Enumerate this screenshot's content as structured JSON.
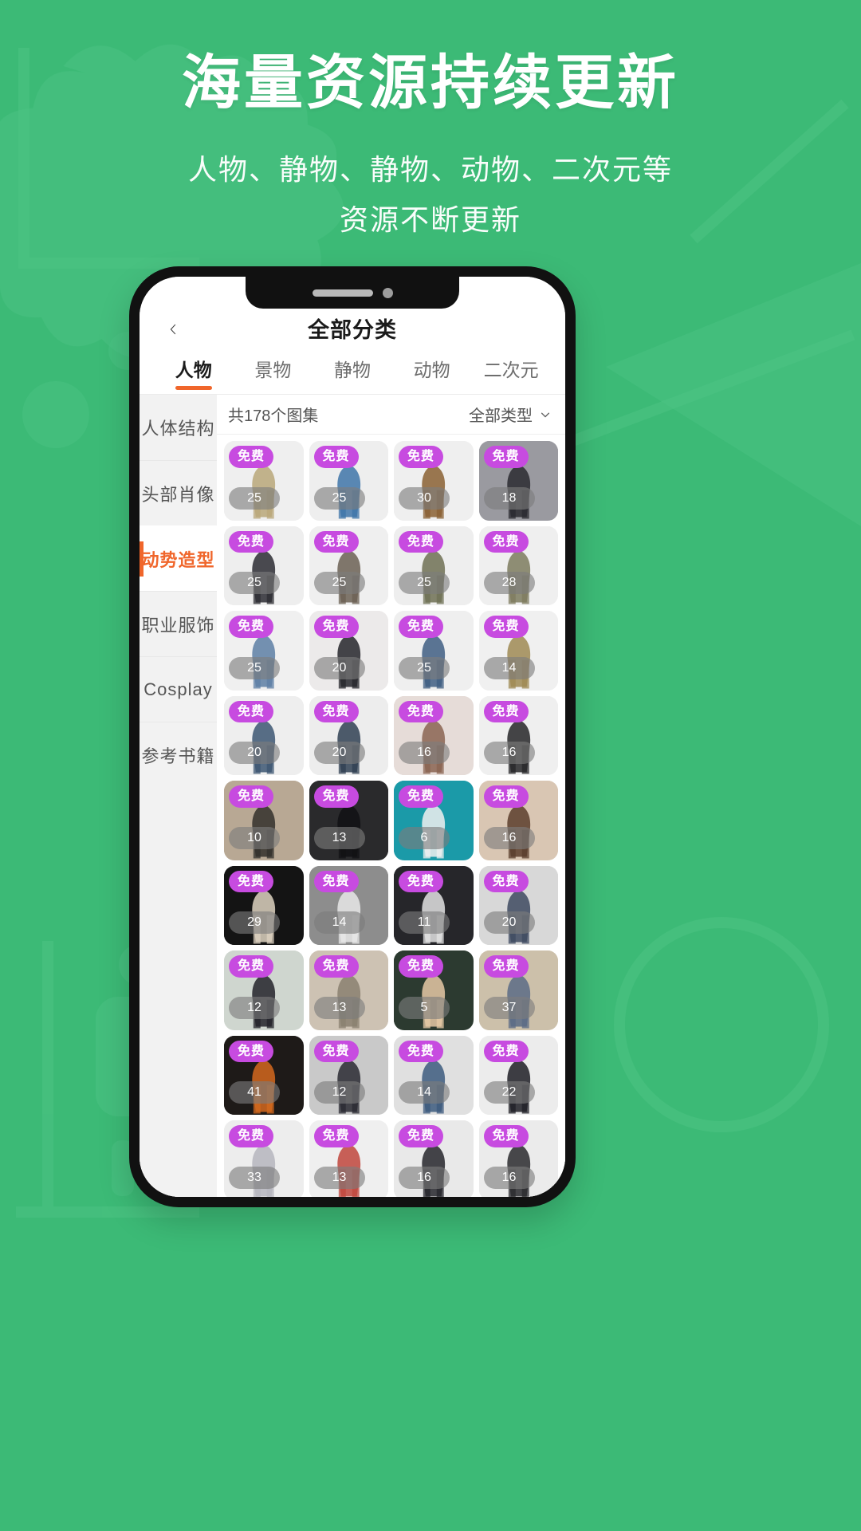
{
  "theme": {
    "bg_green": "#3cba76",
    "accent_orange": "#f0662b",
    "badge_purple": "#c74be0"
  },
  "hero": {
    "title": "海量资源持续更新",
    "subtitle_line1": "人物、静物、静物、动物、二次元等",
    "subtitle_line2": "资源不断更新"
  },
  "app": {
    "nav": {
      "back_icon": "chevron-left-icon",
      "title": "全部分类"
    },
    "tabs": [
      {
        "label": "人物",
        "active": true
      },
      {
        "label": "景物",
        "active": false
      },
      {
        "label": "静物",
        "active": false
      },
      {
        "label": "动物",
        "active": false
      },
      {
        "label": "二次元",
        "active": false
      }
    ],
    "sidebar": [
      {
        "label": "人体结构",
        "active": false
      },
      {
        "label": "头部肖像",
        "active": false
      },
      {
        "label": "动势造型",
        "active": true
      },
      {
        "label": "职业服饰",
        "active": false
      },
      {
        "label": "Cosplay",
        "active": false
      },
      {
        "label": "参考书籍",
        "active": false
      }
    ],
    "content_header": {
      "count_text": "共178个图集",
      "filter_label": "全部类型",
      "filter_icon": "chevron-down-icon"
    },
    "grid": {
      "free_badge_label": "免费",
      "items": [
        {
          "count": "25",
          "tone": "#efefef",
          "figure": "#b9a779"
        },
        {
          "count": "25",
          "tone": "#eeeeee",
          "figure": "#3e74a8"
        },
        {
          "count": "30",
          "tone": "#efefef",
          "figure": "#8a6033"
        },
        {
          "count": "18",
          "tone": "#9a9aa0",
          "figure": "#2a2a30"
        },
        {
          "count": "25",
          "tone": "#eeeeee",
          "figure": "#2c2c32"
        },
        {
          "count": "25",
          "tone": "#efefef",
          "figure": "#6b6053"
        },
        {
          "count": "25",
          "tone": "#eeeeee",
          "figure": "#6e7054"
        },
        {
          "count": "28",
          "tone": "#efefef",
          "figure": "#7d7b5e"
        },
        {
          "count": "25",
          "tone": "#f0f0f0",
          "figure": "#5d7fa5"
        },
        {
          "count": "20",
          "tone": "#eceaea",
          "figure": "#26262b"
        },
        {
          "count": "25",
          "tone": "#efefef",
          "figure": "#3f5e82"
        },
        {
          "count": "14",
          "tone": "#f0f0f0",
          "figure": "#9f8a53"
        },
        {
          "count": "20",
          "tone": "#eeeeee",
          "figure": "#3c5672"
        },
        {
          "count": "20",
          "tone": "#ededed",
          "figure": "#2f3f52"
        },
        {
          "count": "16",
          "tone": "#e6dcd8",
          "figure": "#8a6452"
        },
        {
          "count": "16",
          "tone": "#efefef",
          "figure": "#262628"
        },
        {
          "count": "10",
          "tone": "#b8a894",
          "figure": "#32302c"
        },
        {
          "count": "13",
          "tone": "#2a2a2c",
          "figure": "#111114"
        },
        {
          "count": "6",
          "tone": "#1b9aa8",
          "figure": "#f0f0f0"
        },
        {
          "count": "16",
          "tone": "#d9c6b3",
          "figure": "#5a3d2c"
        },
        {
          "count": "29",
          "tone": "#141414",
          "figure": "#ddd2c0"
        },
        {
          "count": "14",
          "tone": "#8d8d8d",
          "figure": "#e8e8e8"
        },
        {
          "count": "11",
          "tone": "#26262a",
          "figure": "#e3e3e3"
        },
        {
          "count": "20",
          "tone": "#d8d8d8",
          "figure": "#3e4a60"
        },
        {
          "count": "12",
          "tone": "#cfd6cf",
          "figure": "#23232a"
        },
        {
          "count": "13",
          "tone": "#cdc2b3",
          "figure": "#8a8070"
        },
        {
          "count": "5",
          "tone": "#2c3a30",
          "figure": "#e6c9a6"
        },
        {
          "count": "37",
          "tone": "#ccc0aa",
          "figure": "#5b6b86"
        },
        {
          "count": "41",
          "tone": "#1e1a18",
          "figure": "#d4691e"
        },
        {
          "count": "12",
          "tone": "#c9c9c9",
          "figure": "#2a2a32"
        },
        {
          "count": "14",
          "tone": "#e0e0e0",
          "figure": "#3c5a7e"
        },
        {
          "count": "22",
          "tone": "#ececec",
          "figure": "#1f1f26"
        },
        {
          "count": "33",
          "tone": "#ededed",
          "figure": "#b5b5bd"
        },
        {
          "count": "13",
          "tone": "#efefef",
          "figure": "#c0453c"
        },
        {
          "count": "16",
          "tone": "#e9e9e9",
          "figure": "#26262c"
        },
        {
          "count": "16",
          "tone": "#ebebeb",
          "figure": "#2a2a2e"
        },
        {
          "count": "",
          "tone": "#efefef",
          "figure": "#9aa0a8"
        },
        {
          "count": "",
          "tone": "#1c1c1e",
          "figure": "#4a4a52"
        },
        {
          "count": "",
          "tone": "#ededed",
          "figure": "#6d737c"
        },
        {
          "count": "",
          "tone": "#e4e4e4",
          "figure": "#55606e"
        }
      ]
    }
  }
}
